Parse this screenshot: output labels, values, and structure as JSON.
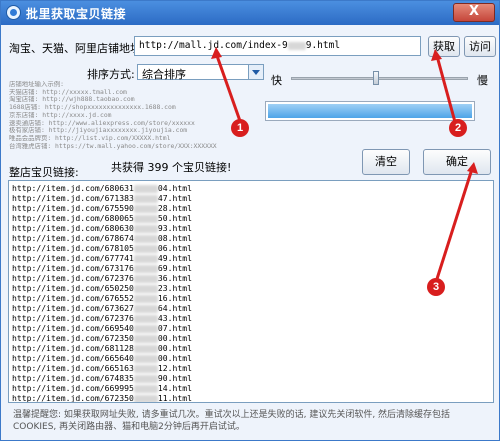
{
  "window": {
    "title": "批里获取宝贝链接",
    "close_label": "X"
  },
  "shop_url": {
    "label": "淘宝、天猫、阿里店铺地址:",
    "value_prefix": "http://mall.jd.com/index-9",
    "value_suffix": "9.html"
  },
  "buttons": {
    "fetch": "获取",
    "visit": "访问",
    "clear": "清空",
    "confirm": "确定"
  },
  "sort": {
    "label": "排序方式:",
    "selected": "综合排序"
  },
  "speed": {
    "fast": "快",
    "slow": "慢",
    "level": 0.48
  },
  "progress": {
    "fraction": 1.0
  },
  "examples": [
    "店铺地址输入示例:",
    "天猫店铺: http://xxxxx.tmall.com",
    "淘宝店铺: http://wjh888.taobao.com",
    "1688店铺: http://shopxxxxxxxxxxxxxx.1688.com",
    "京东店铺: http://xxxx.jd.com",
    "速卖通店铺: http://www.aliexpress.com/store/xxxxxx",
    "极有家店铺: http://jiyoujiaxxxxxxxx.jiyoujia.com",
    "唯品会品牌页: http://list.vip.com/XXXXX.html",
    "台湾雅虎店铺: https://tw.mall.yahoo.com/store/XXX:XXXXXX"
  ],
  "results": {
    "label": "整店宝贝链接:",
    "count_text": "共获得 399 个宝贝链接!",
    "links": [
      {
        "start": "http://item.jd.com/680631",
        "end": "04.html"
      },
      {
        "start": "http://item.jd.com/671383",
        "end": "47.html"
      },
      {
        "start": "http://item.jd.com/675590",
        "end": "28.html"
      },
      {
        "start": "http://item.jd.com/680065",
        "end": "50.html"
      },
      {
        "start": "http://item.jd.com/680630",
        "end": "93.html"
      },
      {
        "start": "http://item.jd.com/678674",
        "end": "08.html"
      },
      {
        "start": "http://item.jd.com/678105",
        "end": "06.html"
      },
      {
        "start": "http://item.jd.com/677741",
        "end": "49.html"
      },
      {
        "start": "http://item.jd.com/673176",
        "end": "69.html"
      },
      {
        "start": "http://item.jd.com/672376",
        "end": "36.html"
      },
      {
        "start": "http://item.jd.com/650250",
        "end": "23.html"
      },
      {
        "start": "http://item.jd.com/676552",
        "end": "16.html"
      },
      {
        "start": "http://item.jd.com/673627",
        "end": "64.html"
      },
      {
        "start": "http://item.jd.com/672376",
        "end": "43.html"
      },
      {
        "start": "http://item.jd.com/669540",
        "end": "07.html"
      },
      {
        "start": "http://item.jd.com/672350",
        "end": "00.html"
      },
      {
        "start": "http://item.jd.com/681128",
        "end": "00.html"
      },
      {
        "start": "http://item.jd.com/665640",
        "end": "00.html"
      },
      {
        "start": "http://item.jd.com/665163",
        "end": "12.html"
      },
      {
        "start": "http://item.jd.com/674835",
        "end": "90.html"
      },
      {
        "start": "http://item.jd.com/669995",
        "end": "14.html"
      },
      {
        "start": "http://item.jd.com/672350",
        "end": "11.html"
      }
    ]
  },
  "tip": "温馨提醒您: 如果获取网址失败, 请多重试几次。重试次以上还是失败的话, 建议先关闭软件, 然后清除缓存包括COOKIES, 再关闭路由器、猫和电脑2分钟后再开启试试。",
  "annotations": {
    "color": "#d81e1e",
    "markers": [
      "1",
      "2",
      "3"
    ]
  }
}
